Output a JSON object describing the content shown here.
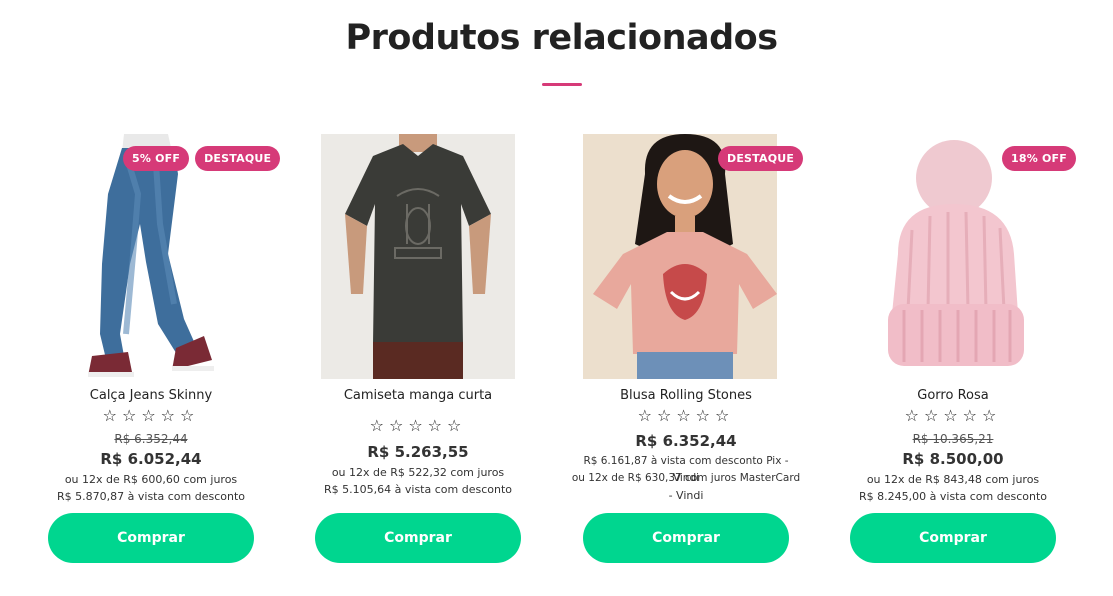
{
  "section": {
    "title": "Produtos relacionados"
  },
  "colors": {
    "accent": "#d63a78",
    "button": "#00d68f",
    "badge": "#d63a78"
  },
  "products": [
    {
      "name": "Calça Jeans Skinny",
      "badges": [
        "5% OFF",
        "DESTAQUE"
      ],
      "rating": "☆☆☆☆☆",
      "old_price": "R$ 6.352,44",
      "price": "R$ 6.052,44",
      "installments": "ou 12x de R$ 600,60 com juros",
      "cash": "R$ 5.870,87 à vista com desconto",
      "button": "Comprar",
      "image": "jeans-image"
    },
    {
      "name": "Camiseta manga curta",
      "badges": [],
      "rating": "☆☆☆☆☆",
      "price": "R$ 5.263,55",
      "installments": "ou 12x de R$ 522,32 com juros",
      "cash": "R$ 5.105,64 à vista com desconto",
      "button": "Comprar",
      "image": "tshirt-image"
    },
    {
      "name": "Blusa Rolling Stones",
      "badges": [
        "DESTAQUE"
      ],
      "rating": "☆☆☆☆☆",
      "price": "R$ 6.352,44",
      "pix": "R$ 6.161,87 à vista com desconto Pix - Vindi",
      "installments_l1": "ou 12x de R$ 630,37 com juros MasterCard",
      "installments_l2": "- Vindi",
      "button": "Comprar",
      "image": "blouse-image"
    },
    {
      "name": "Gorro Rosa",
      "badges": [
        "18% OFF"
      ],
      "rating": "☆☆☆☆☆",
      "old_price": "R$ 10.365,21",
      "price": "R$ 8.500,00",
      "installments": "ou 12x de R$ 843,48 com juros",
      "cash": "R$ 8.245,00 à vista com desconto",
      "button": "Comprar",
      "image": "beanie-image"
    }
  ]
}
